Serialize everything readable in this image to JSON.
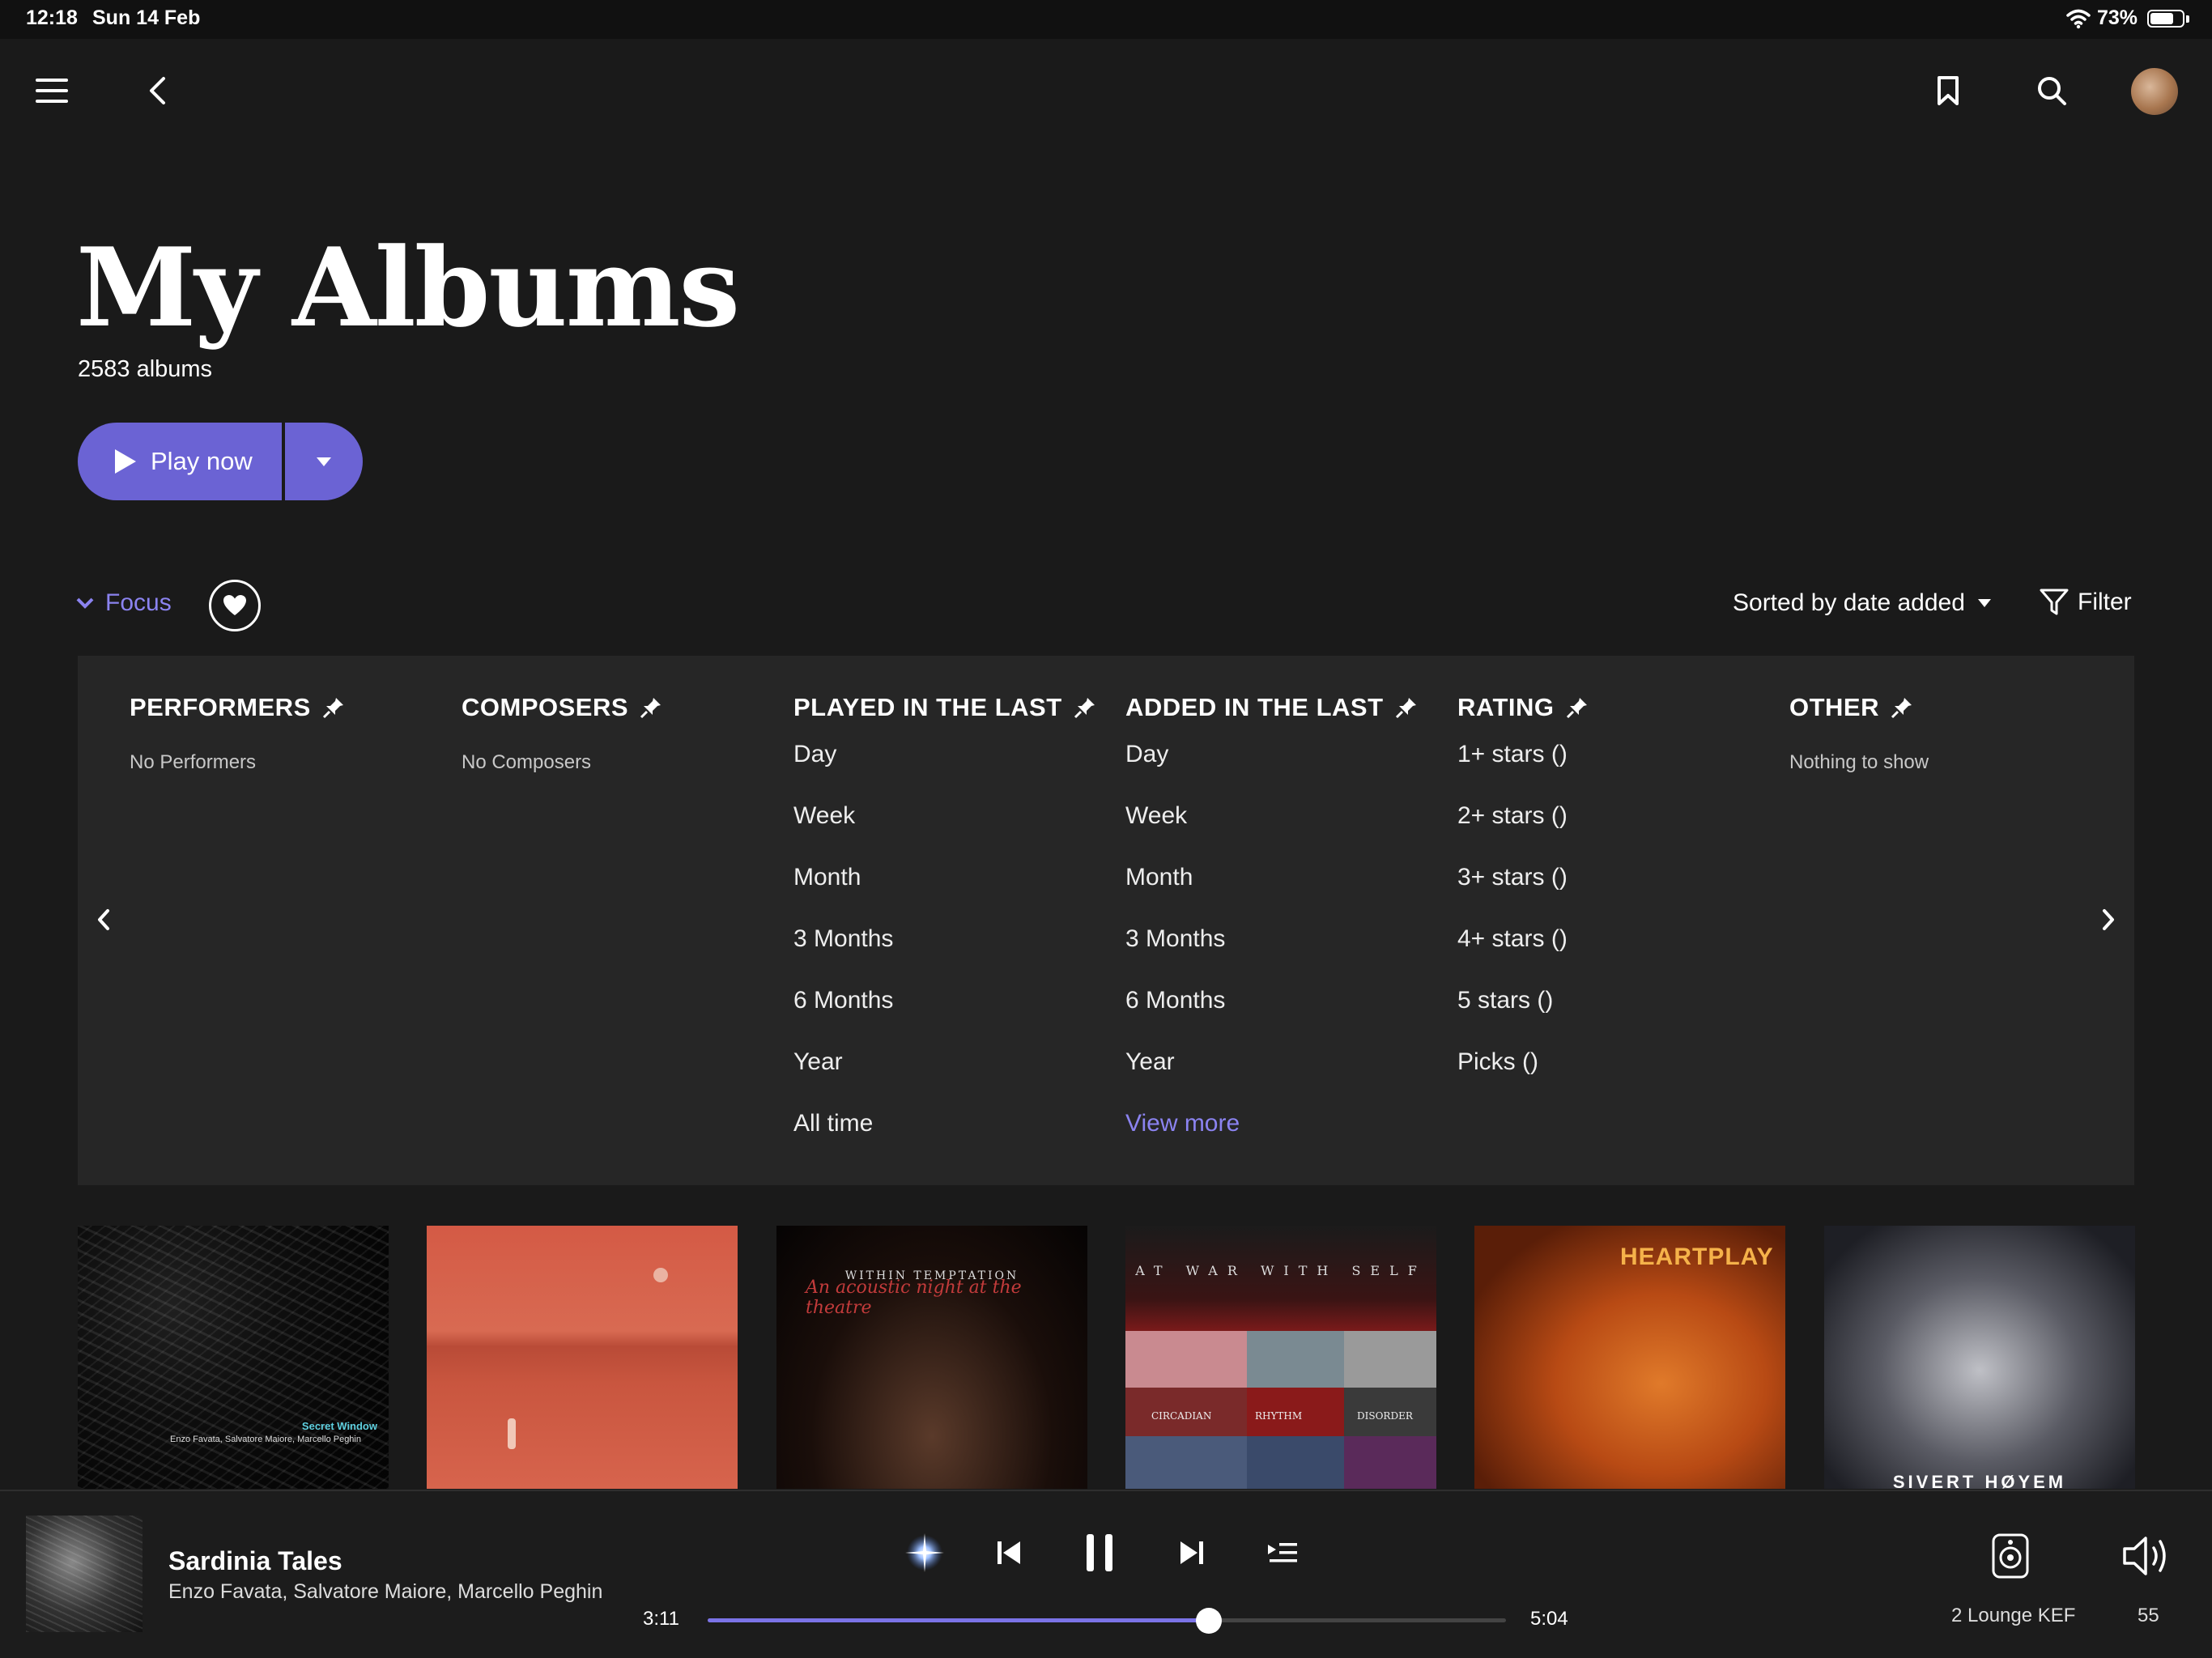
{
  "status_bar": {
    "time": "12:18",
    "date": "Sun 14 Feb",
    "battery": "73%",
    "battery_level": 0.73
  },
  "top_bar": {
    "icons": [
      "menu-icon",
      "back-icon",
      "bookmark-icon",
      "search-icon",
      "avatar"
    ]
  },
  "header": {
    "title": "My Albums",
    "count": "2583 albums"
  },
  "actions": {
    "play_label": "Play now"
  },
  "toolbar": {
    "focus_label": "Focus",
    "sort_label": "Sorted by date added",
    "filter_label": "Filter"
  },
  "filters": {
    "performers": {
      "title": "PERFORMERS",
      "empty": "No Performers"
    },
    "composers": {
      "title": "COMPOSERS",
      "empty": "No Composers"
    },
    "played": {
      "title": "PLAYED IN THE LAST",
      "items": [
        "Day",
        "Week",
        "Month",
        "3 Months",
        "6 Months",
        "Year",
        "All time"
      ]
    },
    "added": {
      "title": "ADDED IN THE LAST",
      "items": [
        "Day",
        "Week",
        "Month",
        "3 Months",
        "6 Months",
        "Year"
      ],
      "more": "View more"
    },
    "rating": {
      "title": "RATING",
      "items": [
        "1+ stars ()",
        "2+ stars ()",
        "3+ stars ()",
        "4+ stars ()",
        "5 stars ()",
        "Picks ()"
      ]
    },
    "other": {
      "title": "OTHER",
      "empty": "Nothing to show"
    }
  },
  "albums": [
    {
      "art_text": "Enzo Favata, Salvatore Maiore, Marcello Peghin",
      "art_title": "Secret Window"
    },
    {
      "art_text": ""
    },
    {
      "art_text": "WITHIN TEMPTATION",
      "art_sub": "An acoustic night at the theatre"
    },
    {
      "art_text": "AT WAR WITH SELF",
      "labels": [
        "CIRCADIAN",
        "RHYTHM",
        "DISORDER"
      ]
    },
    {
      "art_text": "HEARTPLAY"
    },
    {
      "art_text": "SIVERT HØYEM"
    }
  ],
  "player": {
    "title": "Sardinia Tales",
    "artist": "Enzo Favata, Salvatore Maiore, Marcello Peghin",
    "elapsed": "3:11",
    "duration": "5:04",
    "progress": 0.628,
    "device": "2 Lounge KEF",
    "volume": "55",
    "accent": "#6b63d4"
  }
}
